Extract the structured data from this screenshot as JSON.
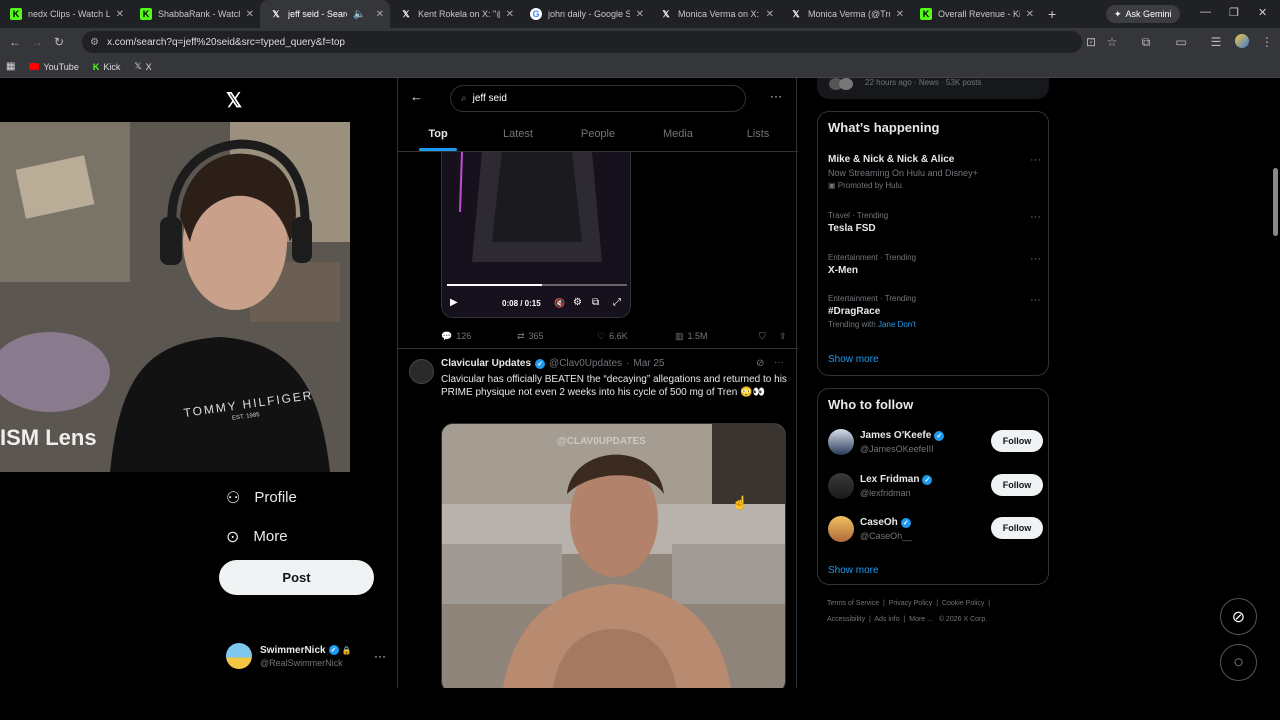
{
  "browser": {
    "tabs": [
      {
        "title": "nedx Clips - Watch Liv",
        "icon": "kick-icon",
        "color": "#53fc18"
      },
      {
        "title": "ShabbaRank - Watch th",
        "icon": "kick-icon",
        "color": "#53fc18"
      },
      {
        "title": "jeff seid - Search / X",
        "icon": "x-icon",
        "color": "#ffffff",
        "active": true
      },
      {
        "title": "Kent Rokela on X: \"@Ja",
        "icon": "x-icon",
        "color": "#ffffff"
      },
      {
        "title": "john daily - Google Sea",
        "icon": "google-icon",
        "color": "#ffffff"
      },
      {
        "title": "Monica Verma on X: \"I",
        "icon": "x-icon",
        "color": "#ffffff"
      },
      {
        "title": "Monica Verma (@Truly",
        "icon": "x-icon",
        "color": "#ffffff"
      },
      {
        "title": "Overall Revenue - Kick",
        "icon": "kick-icon",
        "color": "#53fc18"
      }
    ],
    "ask_gemini": "Ask Gemini",
    "url": "x.com/search?q=jeff%20seid&src=typed_query&f=top",
    "bookmarks": [
      {
        "label": "YouTube",
        "icon": "youtube-icon"
      },
      {
        "label": "Kick",
        "icon": "kick-icon"
      },
      {
        "label": "X",
        "icon": "x-icon"
      }
    ]
  },
  "webcam": {
    "overlay_text": "ISM Lens",
    "shirt_text": "TOMMY HILFIGER",
    "shirt_sub": "EST. 1985"
  },
  "nav": {
    "items": [
      {
        "label": "Profile",
        "icon": "person-icon"
      },
      {
        "label": "More",
        "icon": "more-circle-icon"
      }
    ],
    "post_label": "Post",
    "account": {
      "name": "SwimmerNick",
      "handle": "@RealSwimmerNick"
    }
  },
  "search": {
    "query": "jeff seid",
    "tabs": [
      "Top",
      "Latest",
      "People",
      "Media",
      "Lists"
    ],
    "active_tab": "Top"
  },
  "tweet1": {
    "video_time": "0:08 / 0:15",
    "replies": "126",
    "reposts": "365",
    "likes": "6.6K",
    "views": "1.5M"
  },
  "tweet2": {
    "author": "Clavicular Updates",
    "handle": "@Clav0Updates",
    "date": "Mar 25",
    "text": "Clavicular has officially BEATEN the “decaying” allegations and returned to his PRIME physique not even 2 weeks into his cycle of 500 mg of Tren 😳👀",
    "watermark": "@CLAV0UPDATES"
  },
  "right": {
    "top_card_text": "22 hours ago · News · 53K posts",
    "happening_title": "What’s happening",
    "trends": [
      {
        "meta": "",
        "name": "Mike & Nick & Nick & Alice",
        "sub": "Now Streaming On Hulu and Disney+",
        "promo": "Promoted by Hulu"
      },
      {
        "meta": "Travel · Trending",
        "name": "Tesla FSD",
        "sub": "",
        "promo": ""
      },
      {
        "meta": "Entertainment · Trending",
        "name": "X-Men",
        "sub": "",
        "promo": ""
      },
      {
        "meta": "Entertainment · Trending",
        "name": "#DragRace",
        "sub": "Trending with",
        "link": "Jane Don't",
        "promo": ""
      }
    ],
    "show_more": "Show more",
    "who_title": "Who to follow",
    "follows": [
      {
        "name": "James O'Keefe",
        "handle": "@JamesOKeefeIII",
        "button": "Follow"
      },
      {
        "name": "Lex Fridman",
        "handle": "@lexfridman",
        "button": "Follow"
      },
      {
        "name": "CaseOh",
        "handle": "@CaseOh__",
        "button": "Follow"
      }
    ],
    "show_more_2": "Show more",
    "footer": [
      "Terms of Service",
      "Privacy Policy",
      "Cookie Policy",
      "Accessibility",
      "Ads info",
      "More ...",
      "© 2026 X Corp."
    ]
  }
}
